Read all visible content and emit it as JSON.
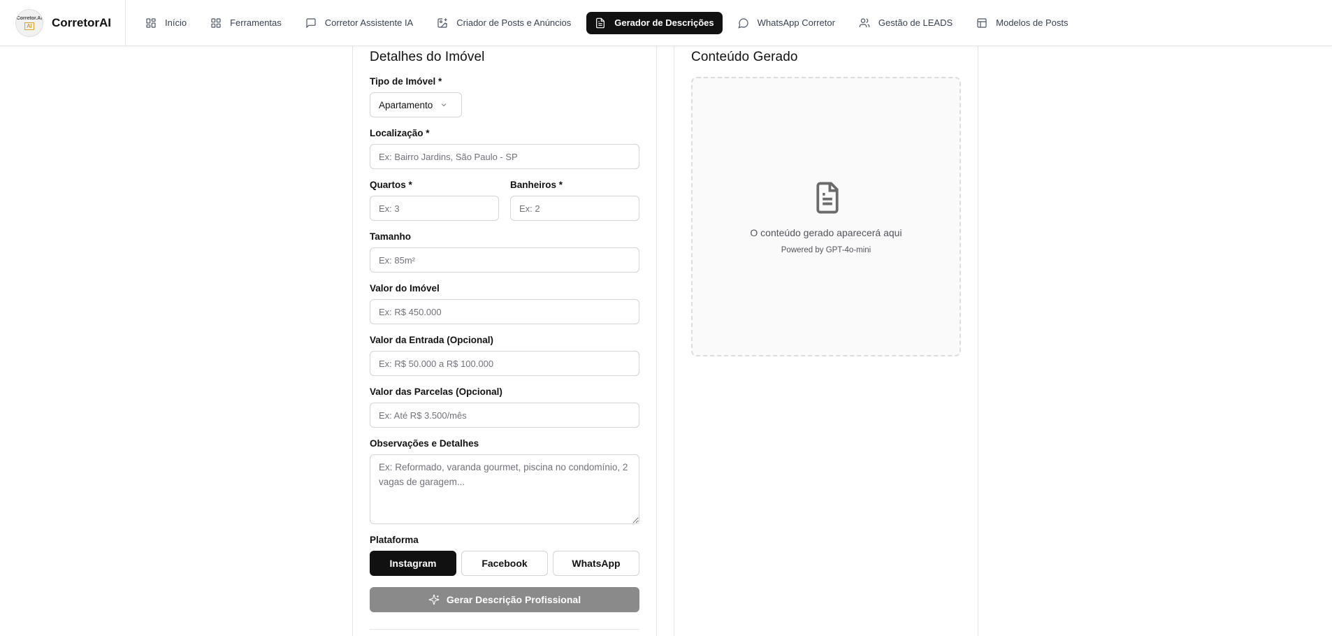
{
  "brand": {
    "name": "CorretorAI",
    "logo_line1": "Corretor.AI",
    "logo_line2": "AI"
  },
  "nav": {
    "items": [
      {
        "label": "Início",
        "icon": "grid-icon",
        "active": false
      },
      {
        "label": "Ferramentas",
        "icon": "grid-icon",
        "active": false
      },
      {
        "label": "Corretor Assistente IA",
        "icon": "chat-icon",
        "active": false
      },
      {
        "label": "Criador de Posts e Anúncios",
        "icon": "image-plus-icon",
        "active": false
      },
      {
        "label": "Gerador de Descrições",
        "icon": "file-text-icon",
        "active": true
      },
      {
        "label": "WhatsApp Corretor",
        "icon": "message-circle-icon",
        "active": false
      },
      {
        "label": "Gestão de LEADS",
        "icon": "users-icon",
        "active": false
      },
      {
        "label": "Modelos de Posts",
        "icon": "layout-icon",
        "active": false
      }
    ]
  },
  "form": {
    "title": "Detalhes do Imóvel",
    "tipo_label": "Tipo de Imóvel *",
    "tipo_value": "Apartamento",
    "localizacao_label": "Localização *",
    "localizacao_placeholder": "Ex: Bairro Jardins, São Paulo - SP",
    "quartos_label": "Quartos *",
    "quartos_placeholder": "Ex: 3",
    "banheiros_label": "Banheiros *",
    "banheiros_placeholder": "Ex: 2",
    "tamanho_label": "Tamanho",
    "tamanho_placeholder": "Ex: 85m²",
    "valor_label": "Valor do Imóvel",
    "valor_placeholder": "Ex: R$ 450.000",
    "entrada_label": "Valor da Entrada (Opcional)",
    "entrada_placeholder": "Ex: R$ 50.000 a R$ 100.000",
    "parcelas_label": "Valor das Parcelas (Opcional)",
    "parcelas_placeholder": "Ex: Até R$ 3.500/mês",
    "obs_label": "Observações e Detalhes",
    "obs_placeholder": "Ex: Reformado, varanda gourmet, piscina no condomínio, 2 vagas de garagem...",
    "plataforma_label": "Plataforma",
    "platforms": [
      "Instagram",
      "Facebook",
      "WhatsApp"
    ],
    "selected_platform": "Instagram",
    "generate_label": "Gerar Descrição Profissional"
  },
  "output": {
    "title": "Conteúdo Gerado",
    "empty_text": "O conteúdo gerado aparecerá aqui",
    "powered_by": "Powered by GPT-4o-mini"
  },
  "colors": {
    "accent": "#111111",
    "button_disabled": "#8a8a8a",
    "border": "#d4d4d8"
  }
}
